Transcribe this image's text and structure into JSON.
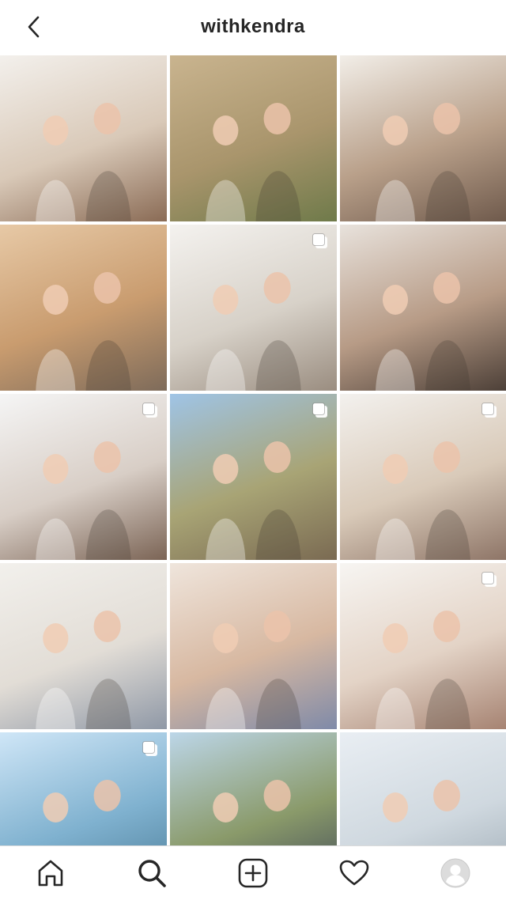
{
  "header": {
    "title": "withkendra",
    "back_icon": "chevron-left-icon"
  },
  "grid": {
    "tiles": [
      {
        "name": "post-kitchen-mom-daughter",
        "colors": [
          "#f3f0ec",
          "#d9c9b8",
          "#8a6b55"
        ],
        "multi": false
      },
      {
        "name": "post-family-field",
        "colors": [
          "#c9b48f",
          "#a9956c",
          "#6f7a4a"
        ],
        "multi": false
      },
      {
        "name": "post-kids-sitting",
        "colors": [
          "#f2eee8",
          "#b9a08a",
          "#6f5a4c"
        ],
        "multi": false
      },
      {
        "name": "post-family-desert",
        "colors": [
          "#e7c9a6",
          "#c99c6f",
          "#7e6b5a"
        ],
        "multi": false
      },
      {
        "name": "post-couch-play",
        "colors": [
          "#f4f2ef",
          "#d7d1c8",
          "#9a8d80"
        ],
        "multi": true
      },
      {
        "name": "post-selfie-baby",
        "colors": [
          "#e8e2dc",
          "#b79b86",
          "#4d4038"
        ],
        "multi": false
      },
      {
        "name": "post-kitchen-counter",
        "colors": [
          "#f5f5f5",
          "#d8cec6",
          "#7b6455"
        ],
        "multi": true
      },
      {
        "name": "post-hillside-run",
        "colors": [
          "#9fc4e6",
          "#a8a475",
          "#7a6a52"
        ],
        "multi": true
      },
      {
        "name": "post-kitchen-family",
        "colors": [
          "#f3f1ee",
          "#d9cab9",
          "#8e7567"
        ],
        "multi": true
      },
      {
        "name": "post-baby-bed",
        "colors": [
          "#f2f0ec",
          "#e2ddd6",
          "#8f98a6"
        ],
        "multi": false
      },
      {
        "name": "post-mirror-selfie",
        "colors": [
          "#efe5dc",
          "#d7b8a1",
          "#7f8aa8"
        ],
        "multi": false
      },
      {
        "name": "post-vanity-girl",
        "colors": [
          "#f7f5f2",
          "#e3d3c6",
          "#a68372"
        ],
        "multi": true
      },
      {
        "name": "post-lake-boat",
        "colors": [
          "#cfe6f7",
          "#7fb1cf",
          "#4a7a95"
        ],
        "multi": true
      },
      {
        "name": "post-mountain-family",
        "colors": [
          "#bcd6e8",
          "#8a9a6a",
          "#3b4457"
        ],
        "multi": false
      },
      {
        "name": "post-beach-lift",
        "colors": [
          "#e9eef3",
          "#cfd8df",
          "#9aa7b1"
        ],
        "multi": false
      }
    ]
  },
  "bottom_nav": {
    "items": [
      {
        "name": "nav-home-icon"
      },
      {
        "name": "nav-search-icon"
      },
      {
        "name": "nav-add-icon"
      },
      {
        "name": "nav-activity-icon"
      },
      {
        "name": "nav-profile-icon"
      }
    ]
  }
}
